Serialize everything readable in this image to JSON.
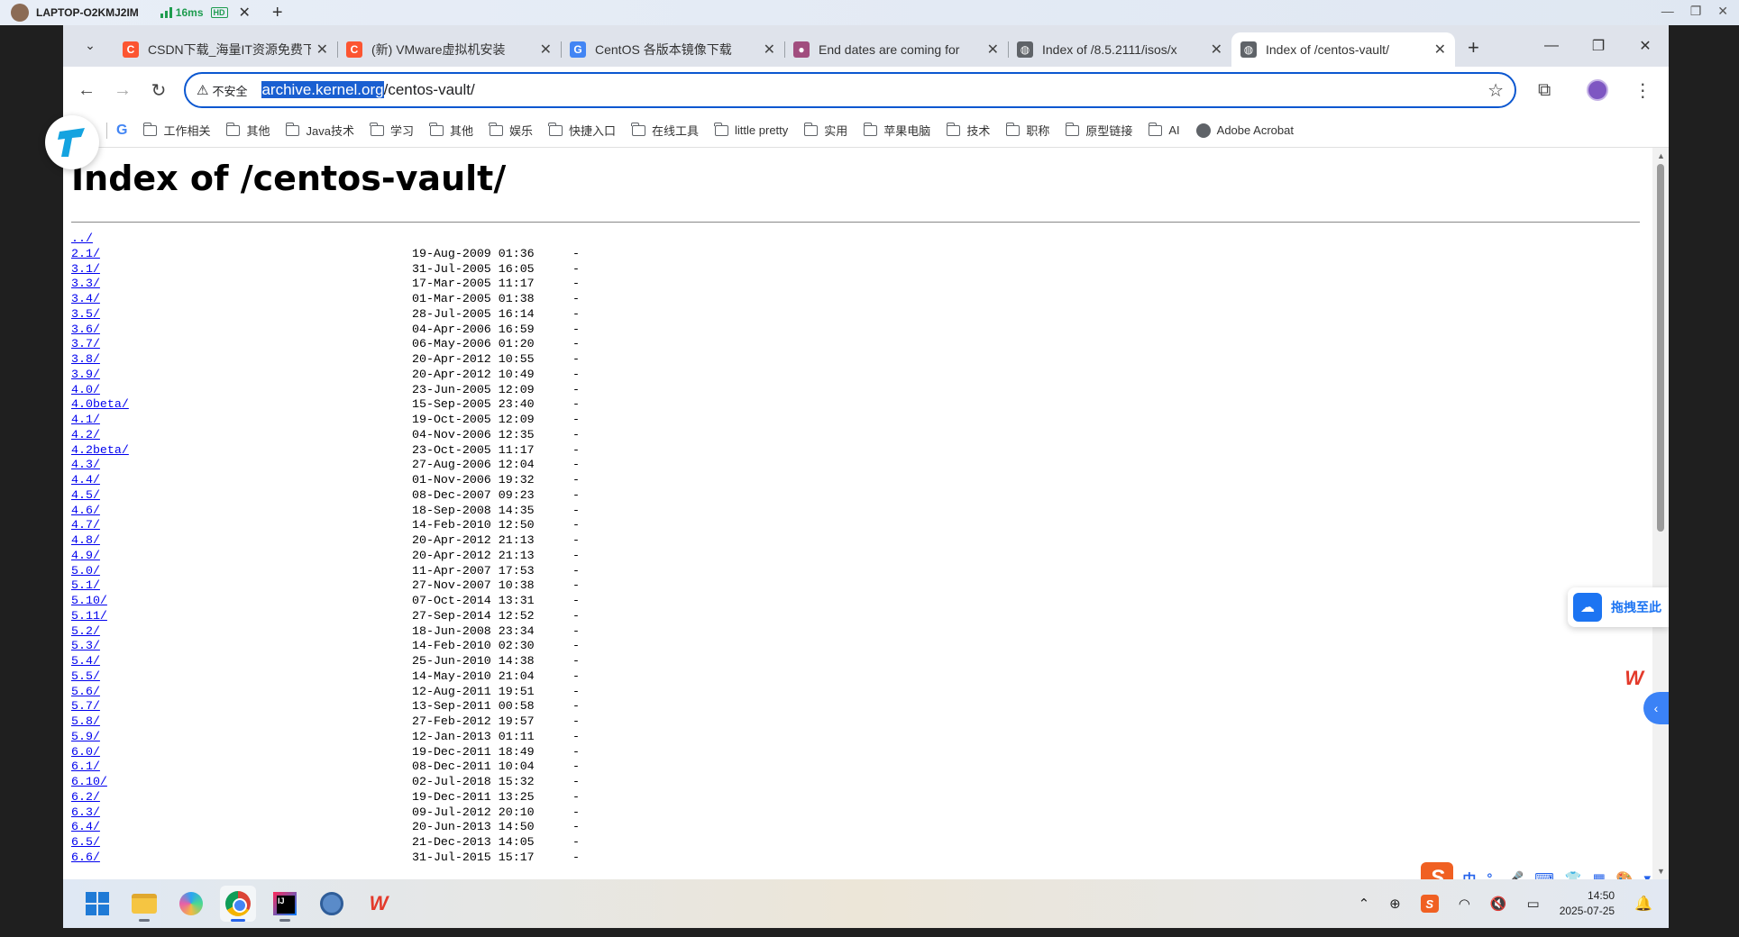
{
  "remote_bar": {
    "host_name": "LAPTOP-O2KMJ2IM",
    "ping": "16ms",
    "quality_badge": "HD",
    "close_icon": "close-icon",
    "new_tab_icon": "plus-icon"
  },
  "tabs": [
    {
      "title": "CSDN下载_海量IT资源免费下载",
      "favicon": "C",
      "favicon_color": "#fc5531"
    },
    {
      "title": "(新) VMware虚拟机安装",
      "favicon": "C",
      "favicon_color": "#fc5531"
    },
    {
      "title": "CentOS 各版本镜像下载",
      "favicon": "G",
      "favicon_color": "#4285f4"
    },
    {
      "title": "End dates are coming for",
      "favicon": "●",
      "favicon_color": "#a14d7e"
    },
    {
      "title": "Index of /8.5.2111/isos/x",
      "favicon": "◍",
      "favicon_color": "#5f6368"
    },
    {
      "title": "Index of /centos-vault/",
      "favicon": "◍",
      "favicon_color": "#5f6368",
      "active": true
    }
  ],
  "address_bar": {
    "security_label": "不安全",
    "host": "archive.kernel.org",
    "path": "/centos-vault/"
  },
  "bookmarks": [
    {
      "label": "工作相关",
      "icon": "folder-icon"
    },
    {
      "label": "其他",
      "icon": "folder-icon"
    },
    {
      "label": "Java技术",
      "icon": "folder-icon"
    },
    {
      "label": "学习",
      "icon": "folder-icon"
    },
    {
      "label": "其他",
      "icon": "folder-icon"
    },
    {
      "label": "娱乐",
      "icon": "folder-icon"
    },
    {
      "label": "快捷入口",
      "icon": "folder-icon"
    },
    {
      "label": "在线工具",
      "icon": "folder-icon"
    },
    {
      "label": "little pretty",
      "icon": "folder-icon"
    },
    {
      "label": "实用",
      "icon": "folder-icon"
    },
    {
      "label": "苹果电脑",
      "icon": "folder-icon"
    },
    {
      "label": "技术",
      "icon": "folder-icon"
    },
    {
      "label": "职称",
      "icon": "folder-icon"
    },
    {
      "label": "原型链接",
      "icon": "folder-icon"
    },
    {
      "label": "AI",
      "icon": "folder-icon"
    },
    {
      "label": "Adobe Acrobat",
      "icon": "globe-icon"
    }
  ],
  "page": {
    "title": "Index of /centos-vault/",
    "entries": [
      {
        "name": "../",
        "date": "",
        "size": ""
      },
      {
        "name": "2.1/",
        "date": "19-Aug-2009 01:36",
        "size": "-"
      },
      {
        "name": "3.1/",
        "date": "31-Jul-2005 16:05",
        "size": "-"
      },
      {
        "name": "3.3/",
        "date": "17-Mar-2005 11:17",
        "size": "-"
      },
      {
        "name": "3.4/",
        "date": "01-Mar-2005 01:38",
        "size": "-"
      },
      {
        "name": "3.5/",
        "date": "28-Jul-2005 16:14",
        "size": "-"
      },
      {
        "name": "3.6/",
        "date": "04-Apr-2006 16:59",
        "size": "-"
      },
      {
        "name": "3.7/",
        "date": "06-May-2006 01:20",
        "size": "-"
      },
      {
        "name": "3.8/",
        "date": "20-Apr-2012 10:55",
        "size": "-"
      },
      {
        "name": "3.9/",
        "date": "20-Apr-2012 10:49",
        "size": "-"
      },
      {
        "name": "4.0/",
        "date": "23-Jun-2005 12:09",
        "size": "-"
      },
      {
        "name": "4.0beta/",
        "date": "15-Sep-2005 23:40",
        "size": "-"
      },
      {
        "name": "4.1/",
        "date": "19-Oct-2005 12:09",
        "size": "-"
      },
      {
        "name": "4.2/",
        "date": "04-Nov-2006 12:35",
        "size": "-"
      },
      {
        "name": "4.2beta/",
        "date": "23-Oct-2005 11:17",
        "size": "-"
      },
      {
        "name": "4.3/",
        "date": "27-Aug-2006 12:04",
        "size": "-"
      },
      {
        "name": "4.4/",
        "date": "01-Nov-2006 19:32",
        "size": "-"
      },
      {
        "name": "4.5/",
        "date": "08-Dec-2007 09:23",
        "size": "-"
      },
      {
        "name": "4.6/",
        "date": "18-Sep-2008 14:35",
        "size": "-"
      },
      {
        "name": "4.7/",
        "date": "14-Feb-2010 12:50",
        "size": "-"
      },
      {
        "name": "4.8/",
        "date": "20-Apr-2012 21:13",
        "size": "-"
      },
      {
        "name": "4.9/",
        "date": "20-Apr-2012 21:13",
        "size": "-"
      },
      {
        "name": "5.0/",
        "date": "11-Apr-2007 17:53",
        "size": "-"
      },
      {
        "name": "5.1/",
        "date": "27-Nov-2007 10:38",
        "size": "-"
      },
      {
        "name": "5.10/",
        "date": "07-Oct-2014 13:31",
        "size": "-"
      },
      {
        "name": "5.11/",
        "date": "27-Sep-2014 12:52",
        "size": "-"
      },
      {
        "name": "5.2/",
        "date": "18-Jun-2008 23:34",
        "size": "-"
      },
      {
        "name": "5.3/",
        "date": "14-Feb-2010 02:30",
        "size": "-"
      },
      {
        "name": "5.4/",
        "date": "25-Jun-2010 14:38",
        "size": "-"
      },
      {
        "name": "5.5/",
        "date": "14-May-2010 21:04",
        "size": "-"
      },
      {
        "name": "5.6/",
        "date": "12-Aug-2011 19:51",
        "size": "-"
      },
      {
        "name": "5.7/",
        "date": "13-Sep-2011 00:58",
        "size": "-"
      },
      {
        "name": "5.8/",
        "date": "27-Feb-2012 19:57",
        "size": "-"
      },
      {
        "name": "5.9/",
        "date": "12-Jan-2013 01:11",
        "size": "-"
      },
      {
        "name": "6.0/",
        "date": "19-Dec-2011 18:49",
        "size": "-"
      },
      {
        "name": "6.1/",
        "date": "08-Dec-2011 10:04",
        "size": "-"
      },
      {
        "name": "6.10/",
        "date": "02-Jul-2018 15:32",
        "size": "-"
      },
      {
        "name": "6.2/",
        "date": "19-Dec-2011 13:25",
        "size": "-"
      },
      {
        "name": "6.3/",
        "date": "09-Jul-2012 20:10",
        "size": "-"
      },
      {
        "name": "6.4/",
        "date": "20-Jun-2013 14:50",
        "size": "-"
      },
      {
        "name": "6.5/",
        "date": "21-Dec-2013 14:05",
        "size": "-"
      },
      {
        "name": "6.6/",
        "date": "31-Jul-2015 15:17",
        "size": "-"
      }
    ]
  },
  "overlays": {
    "drag_widget_label": "拖拽至此",
    "ime_items": [
      "中",
      "°,",
      "🎤",
      "⌨",
      "👕",
      "▦",
      "🎨",
      "▾"
    ]
  },
  "taskbar": {
    "apps": [
      {
        "name": "start-button",
        "icon": "windows-start-icon"
      },
      {
        "name": "file-explorer",
        "icon": "folder-icon"
      },
      {
        "name": "copilot",
        "icon": "copilot-icon"
      },
      {
        "name": "chrome",
        "icon": "chrome-icon"
      },
      {
        "name": "intellij-idea",
        "icon": "idea-icon"
      },
      {
        "name": "browser-globe",
        "icon": "globe-icon"
      },
      {
        "name": "wps",
        "icon": "wps-icon"
      }
    ],
    "clock_time": "14:50",
    "clock_date": "2025-07-25"
  },
  "colors": {
    "accent": "#0b57d0",
    "link": "#0000ee",
    "url_highlight": "#1a5fd1"
  }
}
